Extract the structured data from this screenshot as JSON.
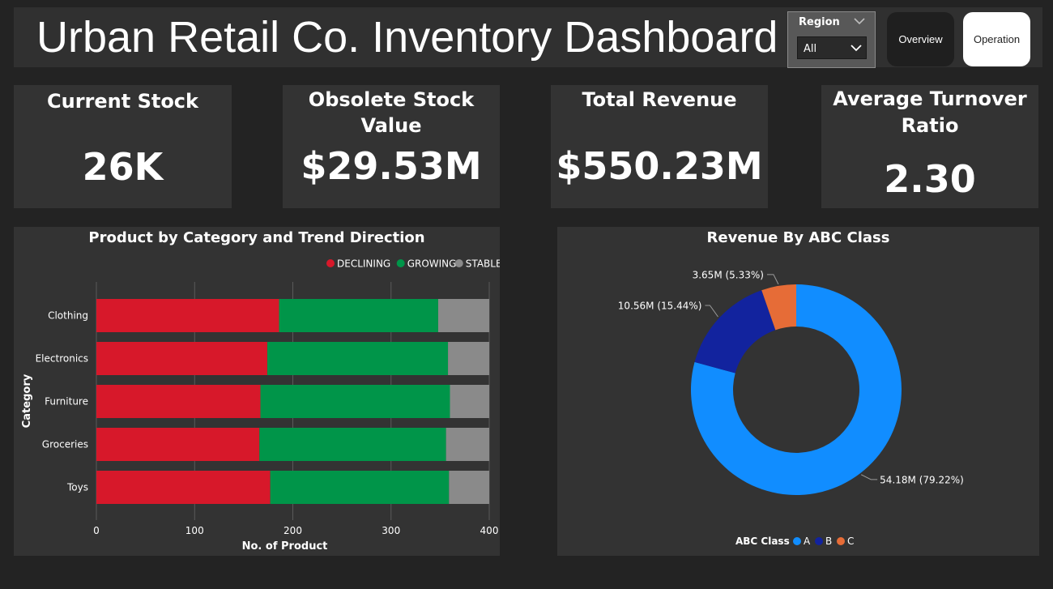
{
  "header": {
    "title": "Urban Retail Co. Inventory Dashboard",
    "region_slicer": {
      "label": "Region",
      "selected": "All"
    },
    "nav": {
      "overview_label": "Overview",
      "operation_label": "Operation"
    }
  },
  "kpis": [
    {
      "label": "Current Stock",
      "value": "26K"
    },
    {
      "label": "Obsolete Stock Value",
      "value": "$29.53M"
    },
    {
      "label_line1": "Average Turnover",
      "label_line2": "Ratio",
      "value": "2.30"
    },
    {
      "label": "Total Revenue",
      "value": "$550.23M"
    }
  ],
  "colors": {
    "declining": "#d7182a",
    "growing": "#009549",
    "stable": "#8a8a8a",
    "class_a": "#118dff",
    "class_b": "#12239e",
    "class_c": "#e66c37"
  },
  "chart_data": [
    {
      "type": "bar",
      "orientation": "horizontal",
      "stacked": true,
      "title": "Product by Category and Trend Direction",
      "xlabel": "No. of Product",
      "ylabel": "Category",
      "categories": [
        "Clothing",
        "Electronics",
        "Furniture",
        "Groceries",
        "Toys"
      ],
      "series": [
        {
          "name": "DECLINING",
          "values": [
            186,
            174,
            167,
            166,
            177
          ]
        },
        {
          "name": "GROWING",
          "values": [
            162,
            184,
            193,
            190,
            182
          ]
        },
        {
          "name": "STABLE",
          "values": [
            52,
            42,
            40,
            44,
            41
          ]
        }
      ],
      "xticks": [
        "0",
        "100",
        "200",
        "300",
        "400"
      ],
      "xlim": [
        0,
        400
      ],
      "grid": true,
      "legend_position": "top-right"
    },
    {
      "type": "pie",
      "variant": "donut",
      "title": "Revenue By ABC Class",
      "legend_title": "ABC Class",
      "legend_position": "bottom",
      "slices": [
        {
          "name": "A",
          "value": 54.18,
          "label": "54.18M (79.22%)"
        },
        {
          "name": "B",
          "value": 10.56,
          "label": "10.56M (15.44%)"
        },
        {
          "name": "C",
          "value": 3.65,
          "label": "3.65M (5.33%)"
        }
      ]
    }
  ]
}
